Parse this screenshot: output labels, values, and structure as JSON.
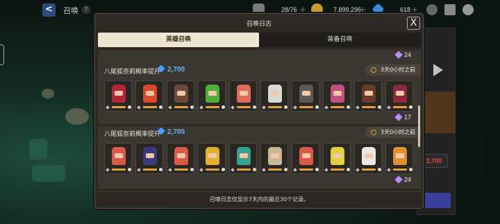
{
  "topbar": {
    "back_label": "<",
    "title": "召唤",
    "help": "?",
    "stamina": "28/76",
    "gold": "7,899,296",
    "gems": "618",
    "plus": "+"
  },
  "modal": {
    "title": "召唤日志",
    "close_label": "X",
    "tabs": [
      {
        "label": "英雄召唤",
        "active": true
      },
      {
        "label": "装备召唤",
        "active": false
      }
    ],
    "top_count": "24",
    "records": [
      {
        "title": "八尾狐奈莉概率提升",
        "cost": "2,700",
        "time": "3天0小时之前",
        "count": "17",
        "heroes": [
          {
            "color": "#b3263a"
          },
          {
            "color": "#d94a2a"
          },
          {
            "color": "#6b4a3a"
          },
          {
            "color": "#4fae3b"
          },
          {
            "color": "#e06a5a"
          },
          {
            "color": "#d8d8d8"
          },
          {
            "color": "#5a5a5a"
          },
          {
            "color": "#c05080"
          },
          {
            "color": "#6a3a2a"
          },
          {
            "color": "#8a2a3a"
          }
        ]
      },
      {
        "title": "八尾狐奈莉概率提升",
        "cost": "2,700",
        "time": "3天0小时之前",
        "count": "24",
        "heroes": [
          {
            "color": "#d95a4a"
          },
          {
            "color": "#3a3a7a"
          },
          {
            "color": "#d95a4a"
          },
          {
            "color": "#e0b030"
          },
          {
            "color": "#3aa090"
          },
          {
            "color": "#c8b89a"
          },
          {
            "color": "#d95a4a"
          },
          {
            "color": "#e0d040"
          },
          {
            "color": "#e8e8e8"
          },
          {
            "color": "#e09030"
          }
        ]
      }
    ],
    "footer": "召唤日志仅显示7天内的最近30个记录。"
  },
  "background": {
    "cost": "2,700"
  }
}
